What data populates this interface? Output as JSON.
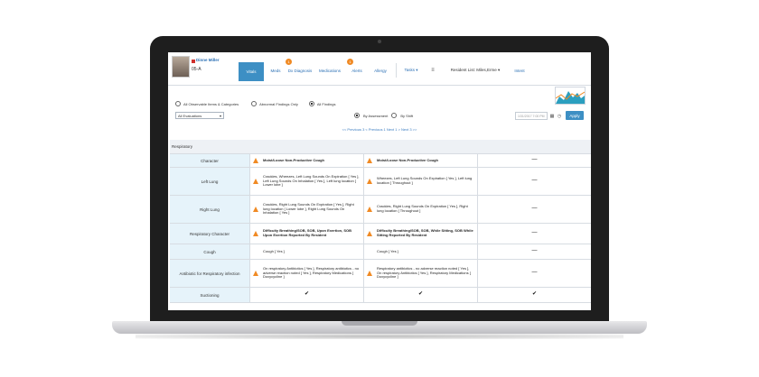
{
  "patient": {
    "name": "Dinne Miller",
    "id": "05-A"
  },
  "tabs": [
    {
      "label": "Vitals",
      "active": true
    },
    {
      "label": "Meds"
    },
    {
      "label": "Dx Diagnosis"
    },
    {
      "label": "Medications"
    },
    {
      "label": "Alerts"
    },
    {
      "label": "Allergy"
    }
  ],
  "badges": [
    "1",
    "1"
  ],
  "toolbar": {
    "tasks_label": "Tasks ▾",
    "menu_icon": "≡",
    "resident_list": "Resident List: Miles,Erme ▾",
    "intent": "Intent"
  },
  "filters": {
    "opt_all_items": "All Observable Items & Categories",
    "opt_abnormal": "Abnormal Findings Only",
    "opt_all_findings": "All Findings",
    "evaluations": "All Evaluations",
    "by_assessment": "By Assessment",
    "by_shift": "By Shift",
    "date_placeholder": "1/31/2017 7:00 PM",
    "apply": "Apply"
  },
  "pager": "<< Previous 3   < Previous 1   Next 1 >   Next 3 >>",
  "section": "Respiratory",
  "rows": [
    {
      "label": "Character",
      "v1": "Moist/Loose Non-Productive Cough",
      "w1": true,
      "v2": "Moist/Loose Non-Productive Cough",
      "w2": true,
      "v3": "—"
    },
    {
      "label": "Left Lung",
      "v1": "Crackles, Wheezes, Left Lung Sounds On Expiration [ Yes ], Left Lung Sounds On Inhalation [ Yes ], Left lung location [ Lower lobe ]",
      "w1": true,
      "v2": "Wheezes, Left Lung Sounds On Expiration [ Yes ], Left lung location [ Throughout ]",
      "w2": true,
      "v3": "—"
    },
    {
      "label": "Right Lung",
      "v1": "Crackles, Right Lung Sounds On Expiration [ Yes ], Right lung location [ Lower lobe ], Right Lung Sounds On Inhalation [ Yes ]",
      "w1": true,
      "v2": "Crackles, Right Lung Sounds On Expiration [ Yes ], Right lung location [ Throughout ]",
      "w2": true,
      "v3": "—"
    },
    {
      "label": "Respiratory Character",
      "v1": "Difficulty Breathing/SOB, SOB, Upon Exertion, SOB Upon Exertion Reported By Resident",
      "w1": true,
      "v2": "Difficulty Breathing/SOB, SOB, While Sitting, SOB While Sitting Reported By Resident",
      "w2": true,
      "v3": "—"
    },
    {
      "label": "Cough",
      "v1": "Cough [ Yes ]",
      "w1": false,
      "v2": "Cough [ Yes ]",
      "w2": false,
      "v3": "—"
    },
    {
      "label": "Antibiotic for Respiratory infection",
      "v1": "On respiratory Antibiotics [ Yes ], Respiratory antibiotics - no adverse reaction noted [ Yes ], Respiratory Medications [ Doxycycline ]",
      "w1": true,
      "v2": "Respiratory antibiotics - no adverse reaction noted [ Yes ], On respiratory Antibiotics [ Yes ], Respiratory Medications [ Doxycycline ]",
      "w2": true,
      "v3": "—"
    },
    {
      "label": "Suctioning",
      "v1": "✔",
      "w1": false,
      "v2": "✔",
      "w2": false,
      "v3": "✔"
    }
  ]
}
